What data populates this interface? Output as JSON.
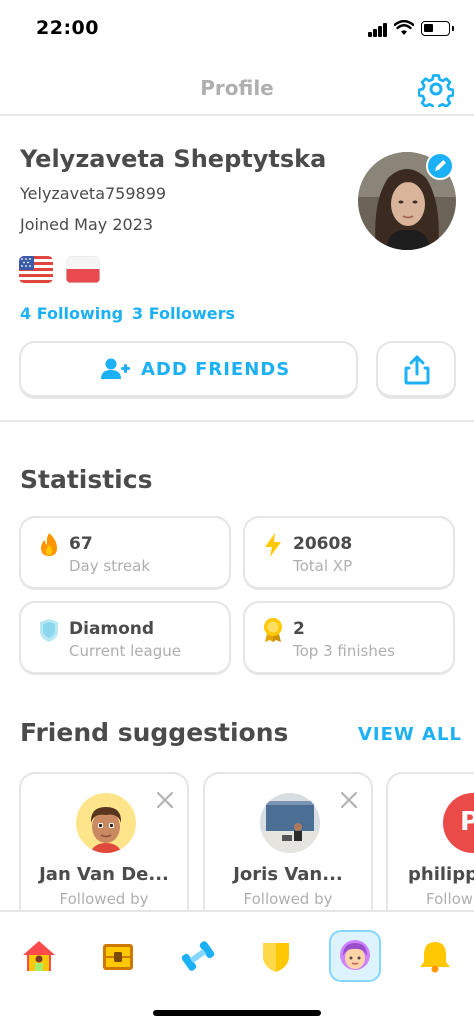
{
  "status_bar": {
    "time": "22:00"
  },
  "header": {
    "title": "Profile"
  },
  "profile": {
    "name": "Yelyzaveta Sheptytska",
    "username": "Yelyzaveta759899",
    "joined": "Joined May 2023",
    "following": "4 Following",
    "followers": "3 Followers",
    "courses": [
      "us-flag",
      "pl-flag"
    ]
  },
  "actions": {
    "add_friends": "ADD FRIENDS"
  },
  "statistics": {
    "title": "Statistics",
    "items": [
      {
        "value": "67",
        "label": "Day streak",
        "icon": "fire-icon"
      },
      {
        "value": "20608",
        "label": "Total XP",
        "icon": "lightning-icon"
      },
      {
        "value": "Diamond",
        "label": "Current league",
        "icon": "diamond-league-icon"
      },
      {
        "value": "2",
        "label": "Top 3 finishes",
        "icon": "medal-icon"
      }
    ]
  },
  "friend_suggestions": {
    "title": "Friend suggestions",
    "view_all": "VIEW ALL",
    "items": [
      {
        "name": "Jan Van De...",
        "subtitle": "Followed by"
      },
      {
        "name": "Joris Van...",
        "subtitle": "Followed by"
      },
      {
        "name": "philipp",
        "subtitle": "Follow",
        "initial": "P"
      }
    ]
  },
  "tabbar": {
    "items": [
      "home-icon",
      "treasure-chest-icon",
      "dumbbell-icon",
      "shield-icon",
      "profile-icon",
      "bell-icon"
    ],
    "active": "profile-icon"
  },
  "colors": {
    "accent": "#1cb0f6",
    "text": "#4b4b4b",
    "muted": "#afafaf",
    "border": "#e5e5e5"
  }
}
